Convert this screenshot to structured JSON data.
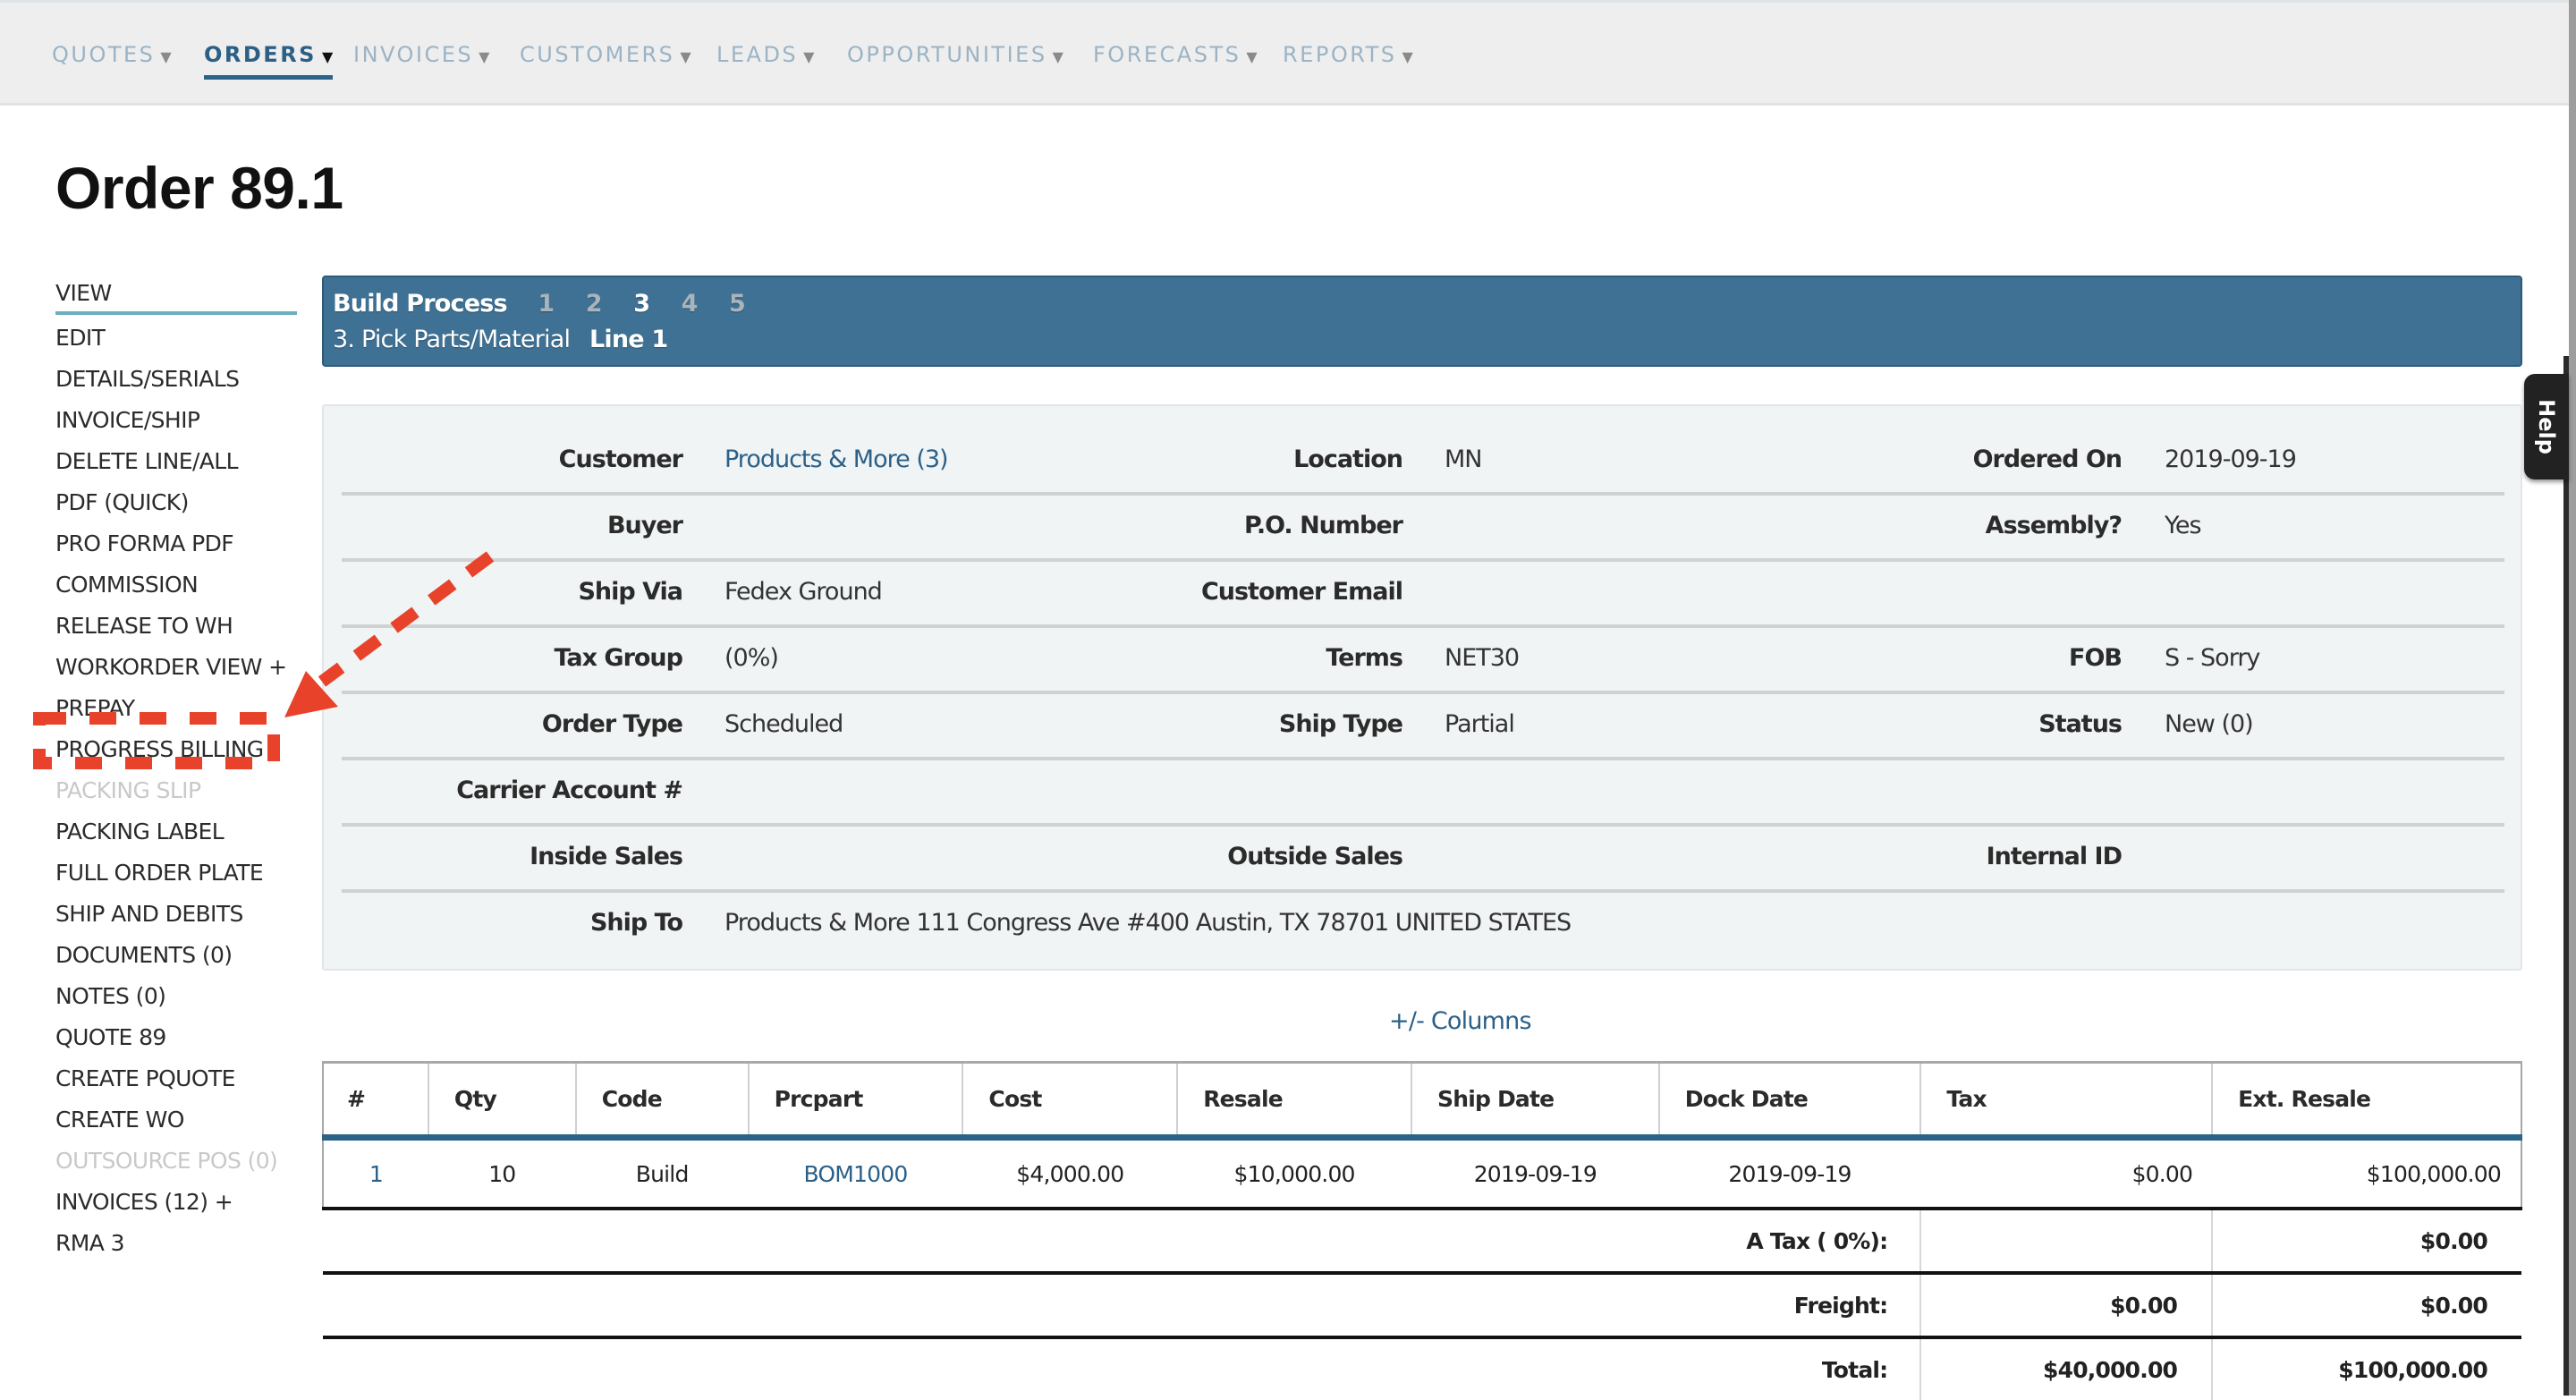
{
  "topnav": {
    "items": [
      {
        "label": "QUOTES",
        "caret": "▼",
        "active": false
      },
      {
        "label": "ORDERS",
        "caret": "▼",
        "active": true
      },
      {
        "label": "INVOICES",
        "caret": "▼",
        "active": false
      },
      {
        "label": "CUSTOMERS",
        "caret": "▼",
        "active": false
      },
      {
        "label": "LEADS",
        "caret": "▼",
        "active": false
      },
      {
        "label": "OPPORTUNITIES",
        "caret": "▼",
        "active": false
      },
      {
        "label": "FORECASTS",
        "caret": "▼",
        "active": false
      },
      {
        "label": "REPORTS",
        "caret": "▼",
        "active": false
      }
    ]
  },
  "page": {
    "title": "Order 89.1"
  },
  "sidebar": {
    "items": [
      {
        "label": "VIEW",
        "state": "active"
      },
      {
        "label": "EDIT",
        "state": "normal"
      },
      {
        "label": "DETAILS/SERIALS",
        "state": "normal"
      },
      {
        "label": "INVOICE/SHIP",
        "state": "normal"
      },
      {
        "label": "DELETE LINE/ALL",
        "state": "normal"
      },
      {
        "label": "PDF (QUICK)",
        "state": "normal"
      },
      {
        "label": "PRO FORMA PDF",
        "state": "normal"
      },
      {
        "label": "COMMISSION",
        "state": "normal"
      },
      {
        "label": "RELEASE TO WH",
        "state": "normal"
      },
      {
        "label": "WORKORDER VIEW +",
        "state": "normal"
      },
      {
        "label": "PREPAY",
        "state": "normal"
      },
      {
        "label": "PROGRESS BILLING",
        "state": "highlighted"
      },
      {
        "label": "PACKING SLIP",
        "state": "disabled"
      },
      {
        "label": "PACKING LABEL",
        "state": "normal"
      },
      {
        "label": "FULL ORDER PLATE",
        "state": "normal"
      },
      {
        "label": "SHIP AND DEBITS",
        "state": "normal"
      },
      {
        "label": "DOCUMENTS (0)",
        "state": "normal"
      },
      {
        "label": "NOTES (0)",
        "state": "normal"
      },
      {
        "label": "QUOTE 89",
        "state": "normal"
      },
      {
        "label": "CREATE PQUOTE",
        "state": "normal"
      },
      {
        "label": "CREATE WO",
        "state": "normal"
      },
      {
        "label": "OUTSOURCE POS (0)",
        "state": "disabled"
      },
      {
        "label": "INVOICES (12) +",
        "state": "normal"
      },
      {
        "label": "RMA 3",
        "state": "normal"
      }
    ]
  },
  "banner": {
    "title": "Build Process",
    "steps": [
      "1",
      "2",
      "3",
      "4",
      "5"
    ],
    "current_step": "3",
    "step_label": "3. Pick Parts/Material",
    "line_ref": "Line 1",
    "bg_color": "#3e7194"
  },
  "help": {
    "label": "Help"
  },
  "info": {
    "rows": [
      {
        "c1": {
          "label": "Customer",
          "value": "Products & More (3)",
          "link": true
        },
        "c2": {
          "label": "Location",
          "value": "MN"
        },
        "c3": {
          "label": "Ordered On",
          "value": "2019-09-19"
        }
      },
      {
        "c1": {
          "label": "Buyer",
          "value": ""
        },
        "c2": {
          "label": "P.O. Number",
          "value": ""
        },
        "c3": {
          "label": "Assembly?",
          "value": "Yes"
        }
      },
      {
        "c1": {
          "label": "Ship Via",
          "value": "Fedex Ground"
        },
        "c2": {
          "label": "Customer Email",
          "value": ""
        },
        "c3": {
          "label": "",
          "value": ""
        }
      },
      {
        "c1": {
          "label": "Tax Group",
          "value": "(0%)"
        },
        "c2": {
          "label": "Terms",
          "value": "NET30"
        },
        "c3": {
          "label": "FOB",
          "value": "S - Sorry"
        }
      },
      {
        "c1": {
          "label": "Order Type",
          "value": "Scheduled"
        },
        "c2": {
          "label": "Ship Type",
          "value": "Partial"
        },
        "c3": {
          "label": "Status",
          "value": "New (0)"
        }
      },
      {
        "c1": {
          "label": "Carrier Account #",
          "value": ""
        },
        "c2": {
          "label": "",
          "value": ""
        },
        "c3": {
          "label": "",
          "value": ""
        }
      },
      {
        "c1": {
          "label": "Inside Sales",
          "value": ""
        },
        "c2": {
          "label": "Outside Sales",
          "value": ""
        },
        "c3": {
          "label": "Internal ID",
          "value": ""
        }
      },
      {
        "c1": {
          "label": "Ship To",
          "value": "Products & More 111 Congress Ave #400 Austin, TX 78701 UNITED STATES"
        },
        "c2": {
          "label": "",
          "value": ""
        },
        "c3": {
          "label": "",
          "value": ""
        }
      }
    ]
  },
  "columns_toggle": {
    "label": "+/- Columns"
  },
  "lines_table": {
    "headers": [
      "#",
      "Qty",
      "Code",
      "Prcpart",
      "Cost",
      "Resale",
      "Ship Date",
      "Dock Date",
      "Tax",
      "Ext. Resale"
    ],
    "rows": [
      {
        "num": "1",
        "qty": "10",
        "code": "Build",
        "prcpart": "BOM1000",
        "cost": "$4,000.00",
        "resale": "$10,000.00",
        "ship_date": "2019-09-19",
        "dock_date": "2019-09-19",
        "tax": "$0.00",
        "ext_resale": "$100,000.00"
      }
    ],
    "summary": [
      {
        "label": "A Tax ( 0%):",
        "cost": "",
        "ext": "$0.00"
      },
      {
        "label": "Freight:",
        "cost": "$0.00",
        "ext": "$0.00"
      },
      {
        "label": "Total:",
        "cost": "$40,000.00",
        "ext": "$100,000.00"
      }
    ]
  },
  "annotation": {
    "color": "#e8432a",
    "target": "PROGRESS BILLING"
  }
}
